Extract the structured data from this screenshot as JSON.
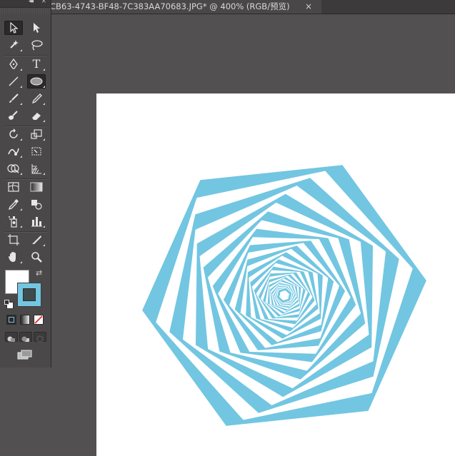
{
  "document_tab": {
    "title": "CB63-4743-BF48-7C383AA70683.JPG* @ 400% (RGB/预览)",
    "close_glyph": "×"
  },
  "tools_panel": {
    "collapse_glyph": "◂◂",
    "close_glyph": "×",
    "tools": [
      {
        "name": "selection-tool",
        "icon": "arrow-select-icon"
      },
      {
        "name": "direct-selection-tool",
        "icon": "direct-select-icon"
      },
      {
        "name": "magic-wand-tool",
        "icon": "magic-wand-icon"
      },
      {
        "name": "lasso-tool",
        "icon": "lasso-icon"
      },
      {
        "name": "pen-tool",
        "icon": "pen-icon"
      },
      {
        "name": "type-tool",
        "icon": "type-icon",
        "label": "T"
      },
      {
        "name": "line-segment-tool",
        "icon": "line-icon"
      },
      {
        "name": "ellipse-tool",
        "icon": "ellipse-icon"
      },
      {
        "name": "paintbrush-tool",
        "icon": "brush-icon"
      },
      {
        "name": "pencil-tool",
        "icon": "pencil-icon"
      },
      {
        "name": "blob-brush-tool",
        "icon": "blob-brush-icon"
      },
      {
        "name": "eraser-tool",
        "icon": "eraser-icon"
      },
      {
        "name": "rotate-tool",
        "icon": "rotate-icon"
      },
      {
        "name": "scale-tool",
        "icon": "scale-icon"
      },
      {
        "name": "warp-tool",
        "icon": "warp-icon"
      },
      {
        "name": "free-transform-tool",
        "icon": "free-transform-icon"
      },
      {
        "name": "shape-builder-tool",
        "icon": "shape-builder-icon"
      },
      {
        "name": "perspective-grid-tool",
        "icon": "perspective-grid-icon"
      },
      {
        "name": "mesh-tool",
        "icon": "mesh-icon"
      },
      {
        "name": "gradient-tool",
        "icon": "gradient-icon"
      },
      {
        "name": "eyedropper-tool",
        "icon": "eyedropper-icon"
      },
      {
        "name": "blend-tool",
        "icon": "blend-icon"
      },
      {
        "name": "symbol-sprayer-tool",
        "icon": "symbol-sprayer-icon"
      },
      {
        "name": "column-graph-tool",
        "icon": "column-graph-icon"
      },
      {
        "name": "artboard-tool",
        "icon": "artboard-icon"
      },
      {
        "name": "slice-tool",
        "icon": "slice-icon"
      },
      {
        "name": "hand-tool",
        "icon": "hand-icon"
      },
      {
        "name": "zoom-tool",
        "icon": "zoom-icon"
      }
    ],
    "active_tools": [
      "selection-tool",
      "ellipse-tool"
    ]
  },
  "colors": {
    "fill": "#ffffff",
    "stroke": "#72c6e1",
    "stroke_inner": "#3f4a4c",
    "artwork": "#72c6e1",
    "canvas_bg": "#535052",
    "artboard": "#ffffff"
  },
  "artwork": {
    "description": "nested rotated hexagons spiral",
    "shape": "hexagon",
    "ring_count": 34
  }
}
